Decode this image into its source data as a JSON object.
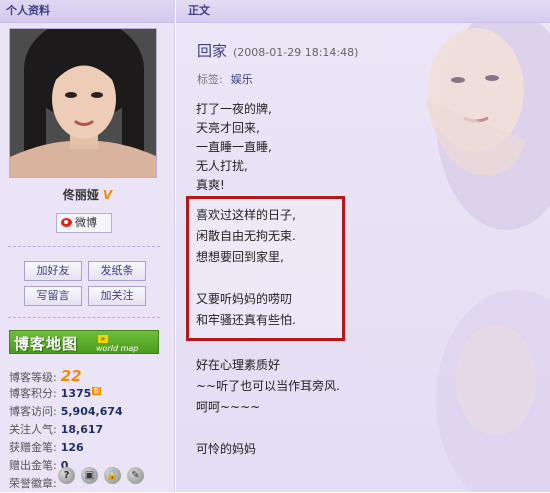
{
  "sidebar": {
    "header": "个人资料",
    "name": "佟丽娅",
    "verified_mark": "V",
    "weibo_label": "微博",
    "buttons": {
      "add_friend": "加好友",
      "send_note": "发纸条",
      "leave_message": "写留言",
      "follow": "加关注"
    },
    "map_banner": {
      "title": "博客地图",
      "subtitle": "world map"
    },
    "stats": [
      {
        "label": "博客等级:",
        "value": "22"
      },
      {
        "label": "博客积分:",
        "value": "1375"
      },
      {
        "label": "博客访问:",
        "value": "5,904,674"
      },
      {
        "label": "关注人气:",
        "value": "18,617"
      },
      {
        "label": "获赠金笔:",
        "value": "126"
      },
      {
        "label": "赠出金笔:",
        "value": "0"
      },
      {
        "label": "荣誉徽章:",
        "value": ""
      }
    ],
    "new_badge": "新",
    "honor_badges": [
      "?",
      "▣",
      "🔒",
      "✎"
    ]
  },
  "main": {
    "header": "正文",
    "title": "回家",
    "time": "(2008-01-29 18:14:48)",
    "tag_label": "标签:",
    "tag": "娱乐",
    "paragraph1": [
      "打了一夜的牌,",
      "天亮才回来,",
      "一直睡一直睡,",
      "无人打扰,",
      "真爽!"
    ],
    "highlighted": [
      "喜欢过这样的日子,",
      "闲散自由无拘无束.",
      "想想要回到家里,",
      "",
      "又要听妈妈的唠叨",
      "和牢骚还真有些怕."
    ],
    "paragraph3": [
      "好在心理素质好",
      "~~听了也可以当作耳旁风.",
      "呵呵~~~~",
      "",
      "可怜的妈妈"
    ]
  },
  "colors": {
    "sidebar_bg": "#eae4f6",
    "accent": "#3d3d8a",
    "highlight_border": "#b51717",
    "map_green": "#4b9a1e",
    "level_orange": "#f08c00"
  }
}
